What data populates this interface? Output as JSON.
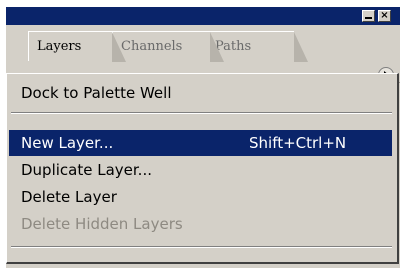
{
  "tabs": [
    {
      "label": "Layers",
      "active": true
    },
    {
      "label": "Channels",
      "active": false
    },
    {
      "label": "Paths",
      "active": false
    }
  ],
  "menu": {
    "items": [
      {
        "label": "Dock to Palette Well",
        "shortcut": "",
        "highlighted": false,
        "disabled": false
      },
      {
        "label": "New Layer...",
        "shortcut": "Shift+Ctrl+N",
        "highlighted": true,
        "disabled": false
      },
      {
        "label": "Duplicate Layer...",
        "shortcut": "",
        "highlighted": false,
        "disabled": false
      },
      {
        "label": "Delete Layer",
        "shortcut": "",
        "highlighted": false,
        "disabled": false
      },
      {
        "label": "Delete Hidden Layers",
        "shortcut": "",
        "highlighted": false,
        "disabled": true
      }
    ]
  },
  "colors": {
    "titlebar": "#0a246a",
    "highlight": "#0a246a",
    "panel": "#d4d0c8",
    "disabled_text": "#8e8a82"
  },
  "icons": [
    "minimize-icon",
    "close-icon",
    "palette-menu-arrow-icon"
  ]
}
